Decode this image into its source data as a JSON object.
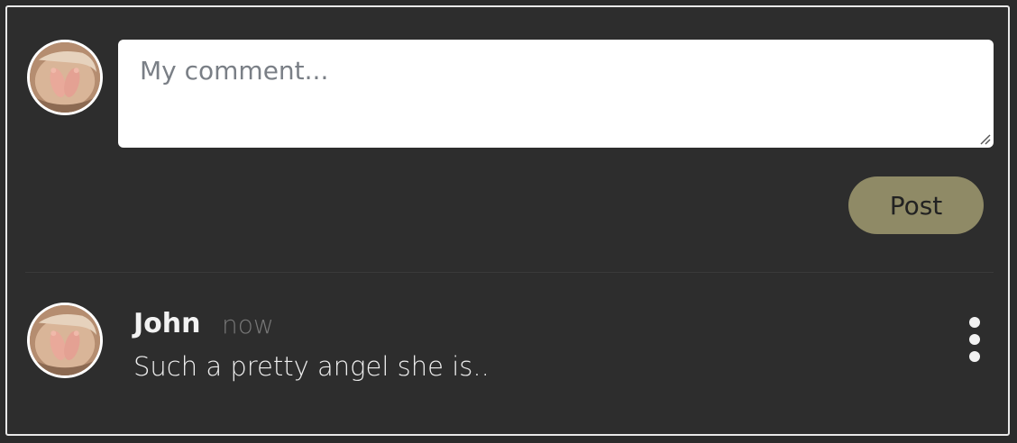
{
  "composer": {
    "placeholder": "My comment...",
    "value": "",
    "post_label": "Post",
    "avatar_icon": "baby-feet-avatar-icon"
  },
  "comments": [
    {
      "author": "John",
      "time": "now",
      "text": "Such a pretty angel she is..",
      "avatar_icon": "baby-feet-avatar-icon",
      "menu_icon": "more-vertical-icon"
    }
  ],
  "colors": {
    "background": "#2d2d2d",
    "post_button": "#8f8a66",
    "border": "#e8e8e8"
  }
}
